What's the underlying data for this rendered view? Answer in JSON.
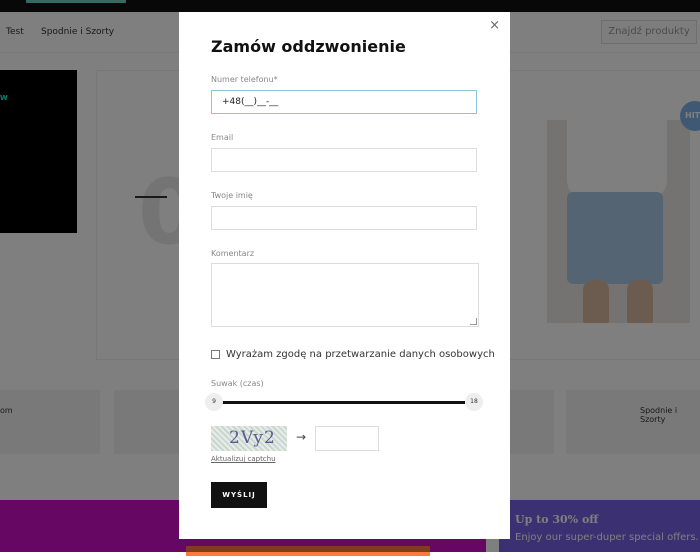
{
  "background": {
    "nav": {
      "link_test": "Test",
      "link_pants": "Spodnie i Szorty",
      "search_button": "Znajdź produkty"
    },
    "promo_black_text": "W",
    "big_digit": "0",
    "hit_badge": "HIT",
    "categories": {
      "left": "om",
      "right": "Spodnie i Szorty"
    },
    "promo": {
      "title": "Up to 30% off",
      "subtitle": "Enjoy our super-duper special offers."
    }
  },
  "modal": {
    "close": "×",
    "title": "Zamów oddzwonienie",
    "phone": {
      "label": "Numer telefonu*",
      "value": "+48(__)__-__"
    },
    "email": {
      "label": "Email",
      "value": ""
    },
    "name": {
      "label": "Twoje imię",
      "value": ""
    },
    "comment": {
      "label": "Komentarz",
      "value": ""
    },
    "consent": {
      "label": "Wyrażam zgodę na przetwarzanie danych osobowych",
      "checked": false
    },
    "slider": {
      "label": "Suwak (czas)",
      "min": "9",
      "max": "18"
    },
    "captcha": {
      "image_text": "2Vy2",
      "arrow": "→",
      "value": "",
      "refresh": "Aktualizuj captchu"
    },
    "submit": "WYŚLIJ"
  },
  "colors": {
    "overlay": "rgba(0,0,0,0.5)",
    "submit_bg": "#111111",
    "promo_pink": "#cc10c6",
    "promo_purple": "#7561e4"
  }
}
